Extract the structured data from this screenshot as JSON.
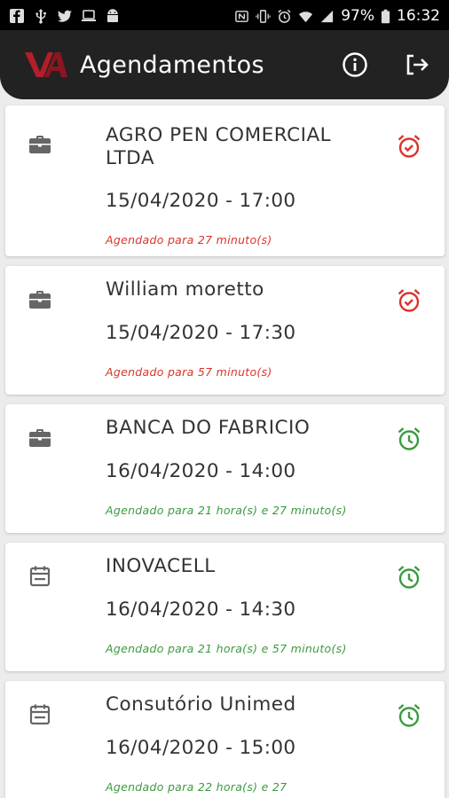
{
  "status_bar": {
    "battery": "97%",
    "time": "16:32",
    "left_icons": [
      "facebook-icon",
      "usb-icon",
      "twitter-icon",
      "laptop-icon",
      "android-icon"
    ],
    "right_icons": [
      "nfc-icon",
      "vibrate-icon",
      "alarm-icon",
      "wifi-icon",
      "signal-icon",
      "battery-icon"
    ]
  },
  "app_bar": {
    "title": "Agendamentos",
    "logo": "VA-logo",
    "actions": [
      "info-icon",
      "logout-icon"
    ]
  },
  "colors": {
    "overdue": "#d9342b",
    "upcoming": "#3a9b3e",
    "app_bar": "#222222",
    "type_icon": "#666666"
  },
  "appointments": [
    {
      "name": "AGRO PEN COMERCIAL LTDA",
      "datetime": "15/04/2020 - 17:00",
      "note": "Agendado para 27 minuto(s)",
      "type_icon": "briefcase-icon",
      "alarm_icon": "alarm-check-icon",
      "status": "red"
    },
    {
      "name": "William moretto",
      "datetime": "15/04/2020 - 17:30",
      "note": "Agendado para 57 minuto(s)",
      "type_icon": "briefcase-icon",
      "alarm_icon": "alarm-check-icon",
      "status": "red"
    },
    {
      "name": "BANCA DO FABRICIO",
      "datetime": "16/04/2020 - 14:00",
      "note": "Agendado para 21 hora(s) e 27 minuto(s)",
      "type_icon": "briefcase-icon",
      "alarm_icon": "alarm-clock-icon",
      "status": "green"
    },
    {
      "name": "INOVACELL",
      "datetime": "16/04/2020 - 14:30",
      "note": "Agendado para 21 hora(s) e 57 minuto(s)",
      "type_icon": "calendar-icon",
      "alarm_icon": "alarm-clock-icon",
      "status": "green"
    },
    {
      "name": "Consutório Unimed",
      "datetime": "16/04/2020 - 15:00",
      "note": "Agendado para 22 hora(s) e 27",
      "type_icon": "calendar-icon",
      "alarm_icon": "alarm-clock-icon",
      "status": "green"
    }
  ]
}
